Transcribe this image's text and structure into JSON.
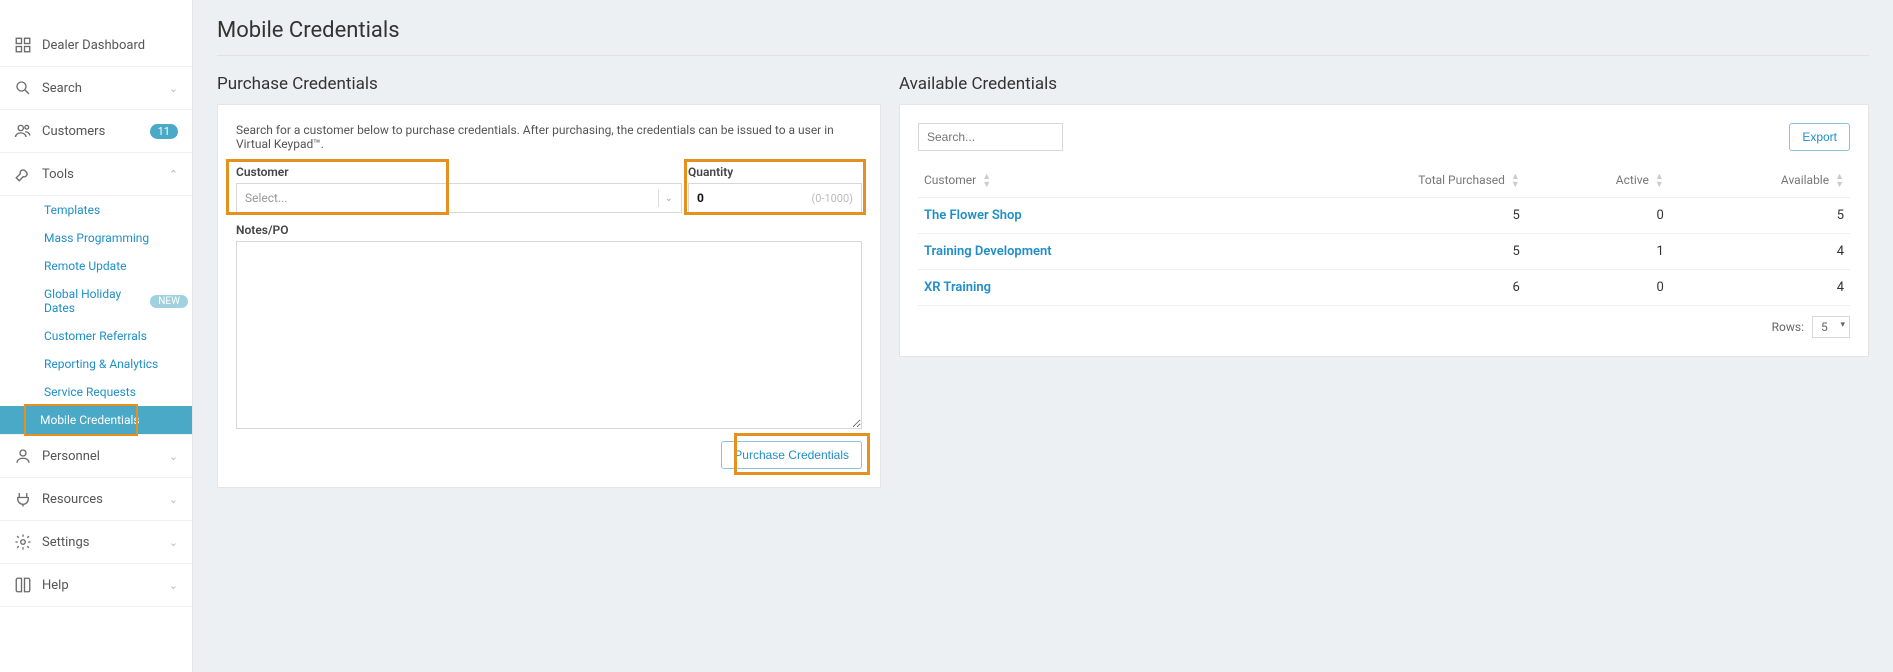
{
  "sidebar": {
    "items": [
      {
        "id": "dealer-dashboard",
        "label": "Dealer Dashboard",
        "icon": "dashboard"
      },
      {
        "id": "search",
        "label": "Search",
        "icon": "search",
        "expandable": true
      },
      {
        "id": "customers",
        "label": "Customers",
        "icon": "customers",
        "badge": "11"
      },
      {
        "id": "tools",
        "label": "Tools",
        "icon": "tools",
        "expandable": true,
        "expanded": true
      },
      {
        "id": "personnel",
        "label": "Personnel",
        "icon": "personnel",
        "expandable": true
      },
      {
        "id": "resources",
        "label": "Resources",
        "icon": "resources",
        "expandable": true
      },
      {
        "id": "settings",
        "label": "Settings",
        "icon": "settings",
        "expandable": true
      },
      {
        "id": "help",
        "label": "Help",
        "icon": "help",
        "expandable": true
      }
    ],
    "tools_submenu": [
      {
        "id": "templates",
        "label": "Templates"
      },
      {
        "id": "mass-programming",
        "label": "Mass Programming"
      },
      {
        "id": "remote-update",
        "label": "Remote Update"
      },
      {
        "id": "global-holiday-dates",
        "label": "Global Holiday Dates",
        "new_badge": "NEW"
      },
      {
        "id": "customer-referrals",
        "label": "Customer Referrals"
      },
      {
        "id": "reporting-analytics",
        "label": "Reporting & Analytics"
      },
      {
        "id": "service-requests",
        "label": "Service Requests"
      },
      {
        "id": "mobile-credentials",
        "label": "Mobile Credentials",
        "selected": true
      }
    ]
  },
  "page": {
    "title": "Mobile Credentials"
  },
  "purchase": {
    "title": "Purchase Credentials",
    "helper": "Search for a customer below to purchase credentials. After purchasing, the credentials can be issued to a user in Virtual Keypad™.",
    "customer_label": "Customer",
    "customer_placeholder": "Select...",
    "quantity_label": "Quantity",
    "quantity_value": "0",
    "quantity_hint": "(0-1000)",
    "notes_label": "Notes/PO",
    "button_label": "Purchase Credentials"
  },
  "available": {
    "title": "Available Credentials",
    "search_placeholder": "Search...",
    "export_label": "Export",
    "columns": {
      "customer": "Customer",
      "total_purchased": "Total Purchased",
      "active": "Active",
      "available": "Available"
    },
    "rows": [
      {
        "customer": "The Flower Shop",
        "total_purchased": "5",
        "active": "0",
        "available": "5"
      },
      {
        "customer": "Training Development",
        "total_purchased": "5",
        "active": "1",
        "available": "4"
      },
      {
        "customer": "XR Training",
        "total_purchased": "6",
        "active": "0",
        "available": "4"
      }
    ],
    "rows_label": "Rows:",
    "rows_value": "5"
  }
}
